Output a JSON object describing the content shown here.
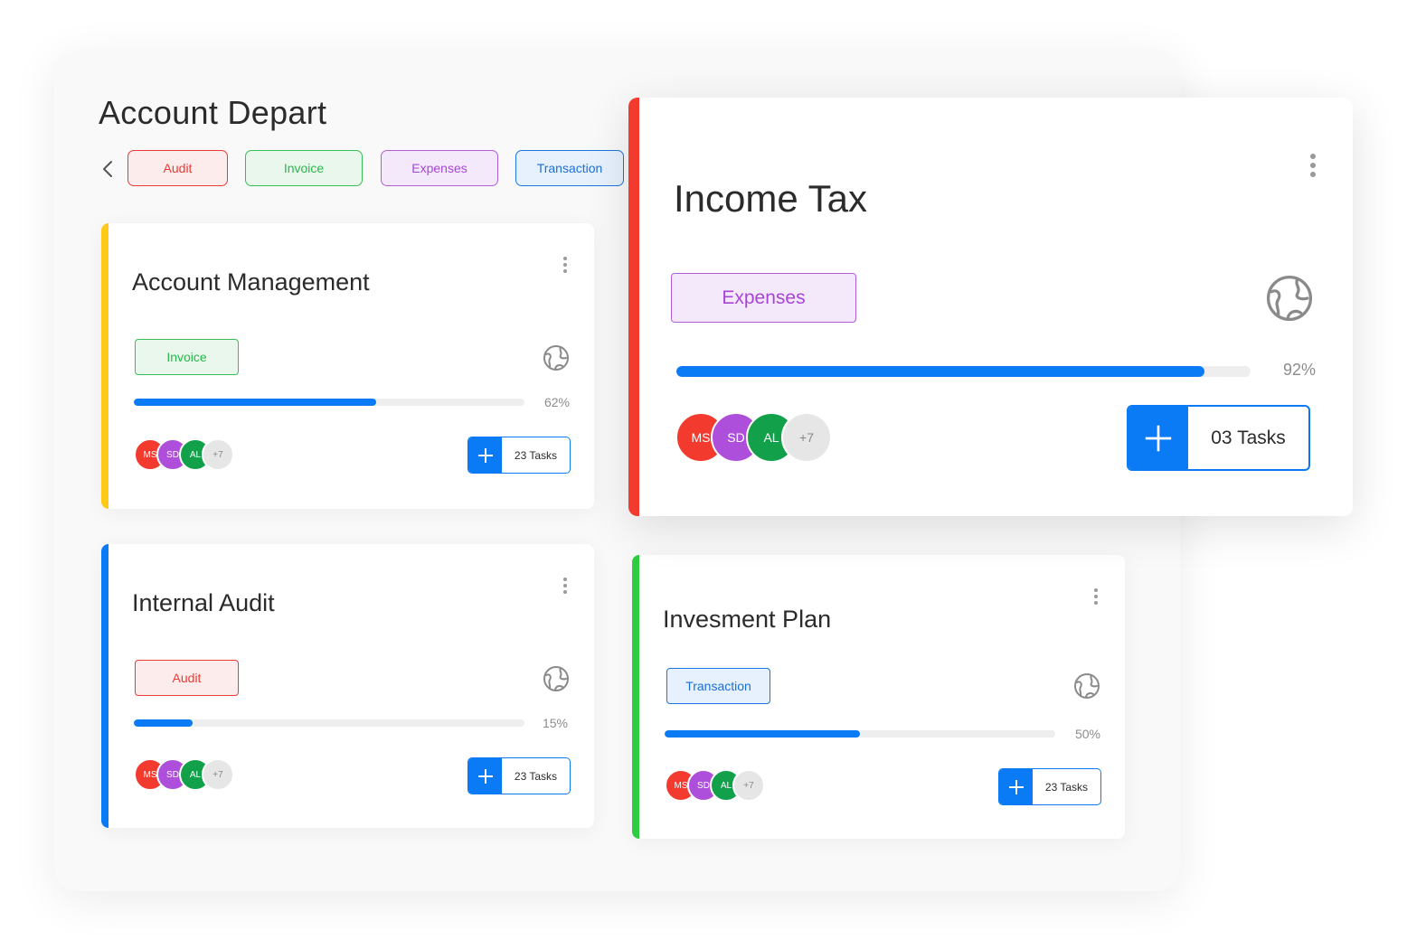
{
  "page": {
    "title": "Account Depart"
  },
  "filters": [
    {
      "label": "Audit",
      "color": "#ec3a35"
    },
    {
      "label": "Invoice",
      "color": "#28b84a"
    },
    {
      "label": "Expenses",
      "color": "#a845d6"
    },
    {
      "label": "Transaction",
      "color": "#1a6fd6"
    }
  ],
  "cards": {
    "account_management": {
      "title": "Account Management",
      "tag": "Invoice",
      "progress": 0.62,
      "progress_label": "62%",
      "avatars": [
        "MS",
        "SD",
        "AL",
        "+7"
      ],
      "tasks": "23 Tasks",
      "accent": "#ffc91a"
    },
    "internal_audit": {
      "title": "Internal Audit",
      "tag": "Audit",
      "progress": 0.15,
      "progress_label": "15%",
      "avatars": [
        "MS",
        "SD",
        "AL",
        "+7"
      ],
      "tasks": "23 Tasks",
      "accent": "#0a7bf4"
    },
    "investment_plan": {
      "title": "Invesment Plan",
      "tag": "Transaction",
      "progress": 0.5,
      "progress_label": "50%",
      "avatars": [
        "MS",
        "SD",
        "AL",
        "+7"
      ],
      "tasks": "23 Tasks",
      "accent": "#2ecc40"
    },
    "income_tax": {
      "title": "Income Tax",
      "tag": "Expenses",
      "progress": 0.92,
      "progress_label": "92%",
      "avatars": [
        "MS",
        "SD",
        "AL",
        "+7"
      ],
      "tasks": "03 Tasks",
      "accent": "#f33a2e"
    }
  },
  "avatar_colors": {
    "MS": "#f33a2e",
    "SD": "#ae4fdb",
    "AL": "#12a04b",
    "more": "#e6e6e6"
  },
  "icons": {
    "back": "chevron-left-icon",
    "menu": "kebab-menu-icon",
    "globe": "globe-icon",
    "add": "plus-icon"
  }
}
